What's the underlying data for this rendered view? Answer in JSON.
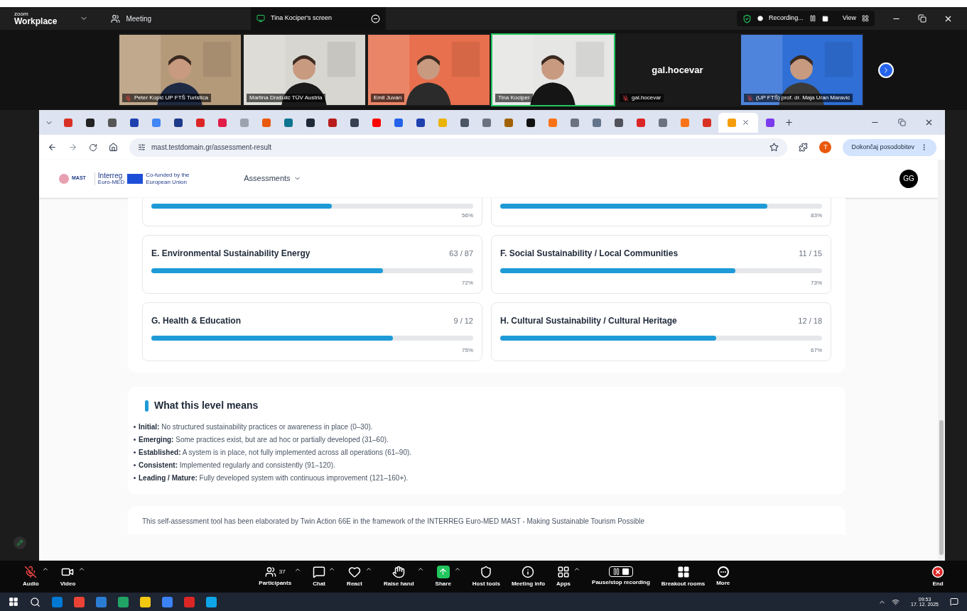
{
  "zoom_bar": {
    "brand_small": "zoom",
    "brand": "Workplace",
    "meeting": "Meeting",
    "share_tab": "Tina Kociper's screen",
    "recording": "Recording...",
    "view": "View"
  },
  "participants": [
    {
      "kind": "video",
      "name": "Peter Kopić UP FTŠ Turistica",
      "muted": true,
      "speaking": false
    },
    {
      "kind": "video",
      "name": "Martina Drašulić TÜV Austria",
      "muted": false,
      "speaking": false
    },
    {
      "kind": "video",
      "name": "Emil Juvan",
      "muted": false,
      "speaking": false
    },
    {
      "kind": "video",
      "name": "Tina Kociper",
      "muted": false,
      "speaking": true
    },
    {
      "kind": "name",
      "display_name": "gal.hocevar",
      "name": "gal.hocevar",
      "muted": true,
      "speaking": false
    },
    {
      "kind": "video",
      "name": "(UP FTŠ) prof. dr. Maja Uran Maravic",
      "muted": true,
      "speaking": false
    }
  ],
  "browser": {
    "tabs": [
      {
        "selected": false,
        "color": "#d93025"
      },
      {
        "selected": false,
        "color": "#222222"
      },
      {
        "selected": false,
        "color": "#555555"
      },
      {
        "selected": false,
        "color": "#1e40af"
      },
      {
        "selected": false,
        "color": "#4285f4"
      },
      {
        "selected": false,
        "color": "#1e3a8a"
      },
      {
        "selected": false,
        "color": "#dc2626"
      },
      {
        "selected": false,
        "color": "#e11d48"
      },
      {
        "selected": false,
        "color": "#9ca3af"
      },
      {
        "selected": false,
        "color": "#ea580c"
      },
      {
        "selected": false,
        "color": "#0e7490"
      },
      {
        "selected": false,
        "color": "#1f2937"
      },
      {
        "selected": false,
        "color": "#b91c1c"
      },
      {
        "selected": false,
        "color": "#374151"
      },
      {
        "selected": false,
        "color": "#ff0000"
      },
      {
        "selected": false,
        "color": "#2563eb"
      },
      {
        "selected": false,
        "color": "#1e40af"
      },
      {
        "selected": false,
        "color": "#eab308"
      },
      {
        "selected": false,
        "color": "#4b5563"
      },
      {
        "selected": false,
        "color": "#6b7280"
      },
      {
        "selected": false,
        "color": "#a16207"
      },
      {
        "selected": false,
        "color": "#111111"
      },
      {
        "selected": false,
        "color": "#f97316"
      },
      {
        "selected": false,
        "color": "#6b7280"
      },
      {
        "selected": false,
        "color": "#64748b"
      },
      {
        "selected": false,
        "color": "#52525b"
      },
      {
        "selected": false,
        "color": "#dc2626"
      },
      {
        "selected": false,
        "color": "#6b7280"
      },
      {
        "selected": false,
        "color": "#f97316"
      },
      {
        "selected": false,
        "color": "#d93025"
      },
      {
        "selected": true,
        "color": "#f59e0b"
      },
      {
        "selected": false,
        "color": "#7c3aed"
      }
    ],
    "url": "mast.testdomain.gr/assessment-result",
    "profile": "T",
    "update_button": "Dokončaj posodobitev"
  },
  "site_header": {
    "logo": "MAST",
    "program": "Interreg",
    "program_sub": "Euro-MED",
    "eu_text": "Co-funded by the European Union",
    "nav": "Assessments",
    "avatar": "GG"
  },
  "partial_scores": [
    {
      "level": 0.56,
      "percent": "56%"
    },
    {
      "level": 0.83,
      "percent": "83%"
    }
  ],
  "scores": [
    {
      "title": "E. Environmental Sustainability Energy",
      "score": "63 / 87",
      "level": 0.72,
      "percent": "72%"
    },
    {
      "title": "F. Social Sustainability / Local Communities",
      "score": "11 / 15",
      "level": 0.73,
      "percent": "73%"
    },
    {
      "title": "G. Health & Education",
      "score": "9 / 12",
      "level": 0.75,
      "percent": "75%"
    },
    {
      "title": "H. Cultural Sustainability / Cultural Heritage",
      "score": "12 / 18",
      "level": 0.67,
      "percent": "67%"
    }
  ],
  "levels": {
    "title": "What this level means",
    "items": [
      "**Initial:** No structured sustainability practices or awareness in place (0–30).",
      "**Emerging:** Some practices exist, but are ad hoc or partially developed (31–60).",
      "**Established:** A system is in place, not fully implemented across all operations (61–90).",
      "**Consistent:** Implemented regularly and consistently (91–120).",
      "**Leading / Mature:** Fully developed system with continuous improvement (121–160+)."
    ]
  },
  "footer_text": "This self-assessment tool has been elaborated by Twin Action 66E in the framework of the INTERREG Euro-MED MAST - Making Sustainable Tourism Possible",
  "meeting_controls": [
    {
      "kind": "mic_off",
      "label": "Audio",
      "caret": true
    },
    {
      "kind": "video",
      "label": "Video",
      "caret": true
    },
    {
      "kind": "participants",
      "label": "Participants",
      "count": "37",
      "caret": true
    },
    {
      "kind": "chat",
      "label": "Chat",
      "caret": true
    },
    {
      "kind": "react",
      "label": "React",
      "caret": true
    },
    {
      "kind": "hand",
      "label": "Raise hand",
      "caret": true
    },
    {
      "kind": "share",
      "label": "Share",
      "caret": true
    },
    {
      "kind": "host",
      "label": "Host tools",
      "caret": false
    },
    {
      "kind": "info",
      "label": "Meeting info",
      "caret": false
    },
    {
      "kind": "apps",
      "label": "Apps",
      "caret": true
    },
    {
      "kind": "record",
      "label": "Pause/stop recording",
      "caret": false
    },
    {
      "kind": "breakout",
      "label": "Breakout rooms",
      "caret": false
    },
    {
      "kind": "more",
      "label": "More",
      "caret": false
    },
    {
      "kind": "end",
      "label": "End",
      "caret": false
    }
  ],
  "taskbar": {
    "apps": [
      {
        "color": "#0078d4"
      },
      {
        "color": "#ea4335"
      },
      {
        "color": "#2b7cd3"
      },
      {
        "color": "#21a366"
      },
      {
        "color": "#f2c811"
      },
      {
        "color": "#3b82f6"
      },
      {
        "color": "#dc2626"
      },
      {
        "color": "#0ea5e9"
      }
    ],
    "time": "09:53",
    "date": "17. 12. 2025"
  }
}
